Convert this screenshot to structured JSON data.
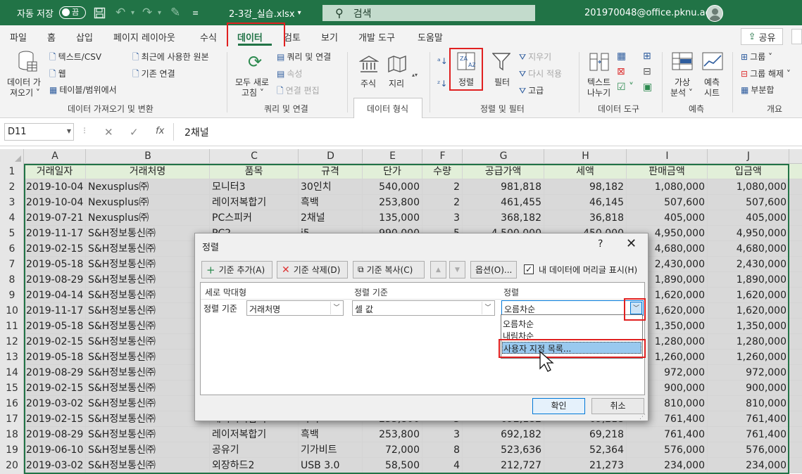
{
  "titlebar": {
    "autosave_label": "자동 저장",
    "autosave_state": "끔",
    "filename": "2-3강_실습.xlsx",
    "filename_caret": "▾",
    "search_placeholder": "검색",
    "account": "201970048@office.pknu.ac.kr"
  },
  "tabs": [
    {
      "label": "파일"
    },
    {
      "label": "홈"
    },
    {
      "label": "삽입"
    },
    {
      "label": "페이지 레이아웃"
    },
    {
      "label": "수식"
    },
    {
      "label": "데이터"
    },
    {
      "label": "검토"
    },
    {
      "label": "보기"
    },
    {
      "label": "개발 도구"
    },
    {
      "label": "도움말"
    }
  ],
  "share_label": "공유",
  "ribbon": {
    "get_data_l1": "데이터 가",
    "get_data_l2": "져오기 ˅",
    "text_csv": "텍스트/CSV",
    "web": "웹",
    "table_range": "테이블/범위에서",
    "recent_sources": "최근에 사용한 원본",
    "existing_conn": "기존 연결",
    "group_get": "데이터 가져오기 및 변환",
    "refresh_l1": "모두 새로",
    "refresh_l2": "고침 ˅",
    "queries_conn": "쿼리 및 연결",
    "properties": "속성",
    "edit_links": "연결 편집",
    "group_queries": "쿼리 및 연결",
    "stocks": "주식",
    "geography": "지리",
    "group_types": "데이터 형식",
    "sort": "정렬",
    "filter": "필터",
    "clear": "지우기",
    "reapply": "다시 적용",
    "advanced": "고급",
    "group_sort": "정렬 및 필터",
    "text_cols_l1": "텍스트",
    "text_cols_l2": "나누기",
    "group_tools": "데이터 도구",
    "whatif_l1": "가상",
    "whatif_l2": "분석 ˅",
    "forecast_l1": "예측",
    "forecast_l2": "시트",
    "group_forecast": "예측",
    "outline_group": "그룹 ˅",
    "outline_ungroup": "그룹 해제 ˅",
    "outline_subtotal": "부분합",
    "group_outline": "개요"
  },
  "formula_bar": {
    "name_box": "D11",
    "fx": "fx",
    "value": "2채널"
  },
  "columns": [
    "A",
    "B",
    "C",
    "D",
    "E",
    "F",
    "G",
    "H",
    "I",
    "J"
  ],
  "row_numbers": [
    "1",
    "2",
    "3",
    "4",
    "5",
    "6",
    "7",
    "8",
    "9",
    "10",
    "11",
    "12",
    "13",
    "14",
    "15",
    "16",
    "17",
    "18",
    "19",
    "20"
  ],
  "table": {
    "headers": [
      "거래일자",
      "거래처명",
      "품목",
      "규격",
      "단가",
      "수량",
      "공급가액",
      "세액",
      "판매금액",
      "입금액"
    ],
    "rows": [
      [
        "2019-10-04",
        "Nexusplus㈜",
        "모니터3",
        "30인치",
        "540,000",
        "2",
        "981,818",
        "98,182",
        "1,080,000",
        "1,080,000"
      ],
      [
        "2019-10-04",
        "Nexusplus㈜",
        "레이저복합기",
        "흑백",
        "253,800",
        "2",
        "461,455",
        "46,145",
        "507,600",
        "507,600"
      ],
      [
        "2019-07-21",
        "Nexusplus㈜",
        "PC스피커",
        "2채널",
        "135,000",
        "3",
        "368,182",
        "36,818",
        "405,000",
        "405,000"
      ],
      [
        "2019-11-17",
        "S&H정보통신㈜",
        "PC2",
        "i5",
        "990,000",
        "5",
        "4,500,000",
        "450,000",
        "4,950,000",
        "4,950,000"
      ],
      [
        "2019-02-15",
        "S&H정보통신㈜",
        "",
        "",
        "",
        "",
        "",
        "",
        "4,680,000",
        "4,680,000"
      ],
      [
        "2019-05-18",
        "S&H정보통신㈜",
        "",
        "",
        "",
        "",
        "",
        "",
        "2,430,000",
        "2,430,000"
      ],
      [
        "2019-08-29",
        "S&H정보통신㈜",
        "",
        "",
        "",
        "",
        "",
        "",
        "1,890,000",
        "1,890,000"
      ],
      [
        "2019-04-14",
        "S&H정보통신㈜",
        "",
        "",
        "",
        "",
        "",
        "",
        "1,620,000",
        "1,620,000"
      ],
      [
        "2019-11-17",
        "S&H정보통신㈜",
        "",
        "",
        "",
        "",
        "",
        "",
        "1,620,000",
        "1,620,000"
      ],
      [
        "2019-05-18",
        "S&H정보통신㈜",
        "",
        "",
        "",
        "",
        "",
        "",
        "1,350,000",
        "1,350,000"
      ],
      [
        "2019-02-15",
        "S&H정보통신㈜",
        "",
        "",
        "",
        "",
        "",
        "",
        "1,280,000",
        "1,280,000"
      ],
      [
        "2019-05-18",
        "S&H정보통신㈜",
        "",
        "",
        "",
        "",
        "",
        "",
        "1,260,000",
        "1,260,000"
      ],
      [
        "2019-08-29",
        "S&H정보통신㈜",
        "",
        "",
        "",
        "",
        "",
        "",
        "972,000",
        "972,000"
      ],
      [
        "2019-02-15",
        "S&H정보통신㈜",
        "",
        "",
        "",
        "",
        "",
        "",
        "900,000",
        "900,000"
      ],
      [
        "2019-03-02",
        "S&H정보통신㈜",
        "",
        "",
        "",
        "",
        "",
        "",
        "810,000",
        "810,000"
      ],
      [
        "2019-02-15",
        "S&H정보통신㈜",
        "레이저복합기",
        "흑백",
        "253,800",
        "3",
        "692,182",
        "69,218",
        "761,400",
        "761,400"
      ],
      [
        "2019-08-29",
        "S&H정보통신㈜",
        "레이저복합기",
        "흑백",
        "253,800",
        "3",
        "692,182",
        "69,218",
        "761,400",
        "761,400"
      ],
      [
        "2019-06-10",
        "S&H정보통신㈜",
        "공유기",
        "기가비트",
        "72,000",
        "8",
        "523,636",
        "52,364",
        "576,000",
        "576,000"
      ],
      [
        "2019-03-02",
        "S&H정보통신㈜",
        "외장하드2",
        "USB 3.0",
        "58,500",
        "4",
        "212,727",
        "21,273",
        "234,000",
        "234,000"
      ]
    ]
  },
  "dialog": {
    "title": "정렬",
    "help": "?",
    "close": "✕",
    "add_level": "기준 추가(A)",
    "delete_level": "기준 삭제(D)",
    "copy_level": "기준 복사(C)",
    "up": "▲",
    "down": "▼",
    "options": "옵션(O)...",
    "header_checkbox": "내 데이터에 머리글 표시(H)",
    "col_header_column": "세로 막대형",
    "col_header_sort_on": "정렬 기준",
    "col_header_order": "정렬",
    "row_label": "정렬 기준",
    "column_value": "거래처명",
    "sort_on_value": "셀 값",
    "order_value": "오름차순",
    "order_options": [
      "오름차순",
      "내림차순",
      "사용자 지정 목록..."
    ],
    "ok": "확인",
    "cancel": "취소"
  },
  "colors": {
    "excel_green": "#217346",
    "header_fill": "#e2efd9",
    "highlight_red": "#e02020",
    "selection_blue": "#99c9ef"
  }
}
